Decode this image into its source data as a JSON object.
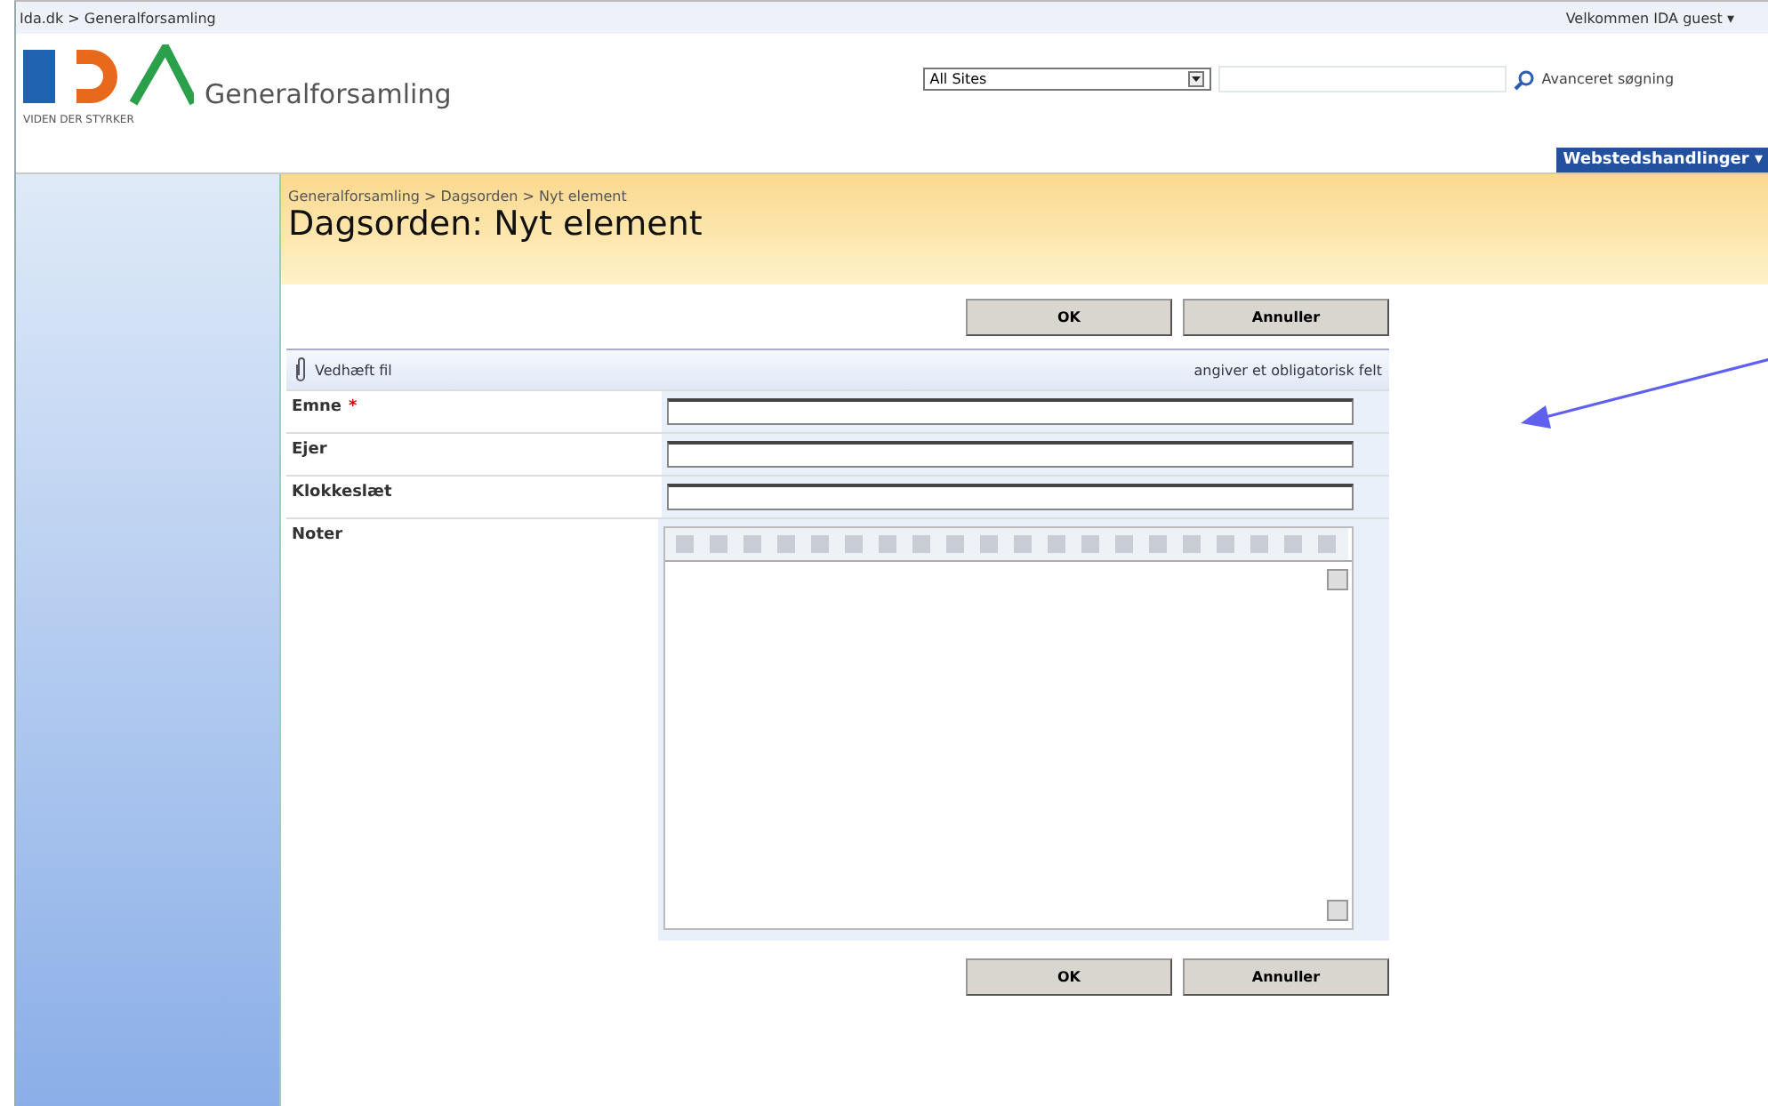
{
  "top_bar": {
    "breadcrumb": "Ida.dk > Generalforsamling",
    "welcome": "Velkommen IDA guest ▾"
  },
  "header": {
    "logo_tagline": "VIDEN DER STYRKER",
    "site_title": "Generalforsamling",
    "scope": "All Sites",
    "advanced_search": "Avanceret søgning",
    "site_actions": "Webstedshandlinger ▾"
  },
  "page": {
    "breadcrumb": "Generalforsamling > Dagsorden > Nyt element",
    "title": "Dagsorden: Nyt element"
  },
  "top_buttons": [
    "OK",
    "Annuller"
  ],
  "bottom_buttons": [
    "OK",
    "Annuller"
  ],
  "required_symbol": "*",
  "form_toolbar": {
    "attach": "Vedhæft fil",
    "required_note": "angiver et obligatorisk felt"
  },
  "fields": [
    {
      "label": "Emne",
      "required": true,
      "kind": "text"
    },
    {
      "label": "Ejer",
      "required": false,
      "kind": "text"
    },
    {
      "label": "Klokkeslæt",
      "required": false,
      "kind": "text"
    },
    {
      "label": "Noter",
      "required": false,
      "kind": "richtext"
    }
  ]
}
